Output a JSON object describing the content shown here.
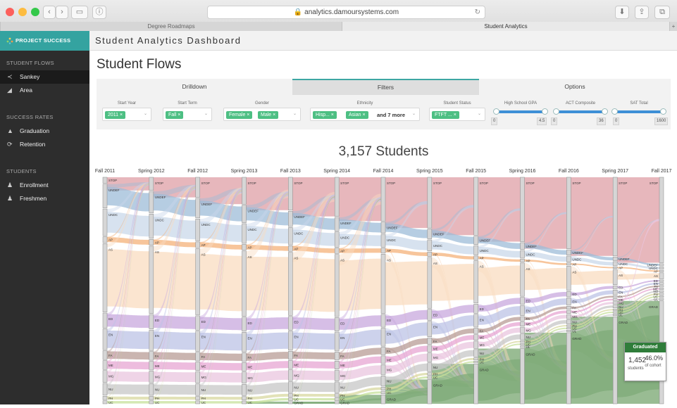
{
  "browser": {
    "url": "analytics.damoursystems.com",
    "tabs": [
      "Degree Roadmaps",
      "Student Analytics"
    ],
    "new_tab": "+"
  },
  "sidebar": {
    "brand": "PROJECT SUCCESS",
    "sections": [
      {
        "title": "STUDENT FLOWS",
        "items": [
          {
            "label": "Sankey",
            "icon": "share-icon",
            "active": true
          },
          {
            "label": "Area",
            "icon": "area-chart-icon"
          }
        ]
      },
      {
        "title": "SUCCESS RATES",
        "items": [
          {
            "label": "Graduation",
            "icon": "graduation-cap-icon"
          },
          {
            "label": "Retention",
            "icon": "refresh-icon"
          }
        ]
      },
      {
        "title": "STUDENTS",
        "items": [
          {
            "label": "Enrollment",
            "icon": "users-icon"
          },
          {
            "label": "Freshmen",
            "icon": "users-icon"
          }
        ]
      }
    ]
  },
  "header": {
    "title": "Student Analytics Dashboard"
  },
  "page": {
    "title": "Student Flows"
  },
  "panel": {
    "tabs": [
      "Drilldown",
      "Filters",
      "Options"
    ],
    "active_tab": "Filters",
    "filters": {
      "start_year": {
        "label": "Start Year",
        "chips": [
          "2011"
        ]
      },
      "start_term": {
        "label": "Start Term",
        "chips": [
          "Fall"
        ]
      },
      "gender": {
        "label": "Gender",
        "chips": [
          "Female",
          "Male"
        ]
      },
      "ethnicity": {
        "label": "Ethnicity",
        "chips": [
          "Hisp...",
          "Asian"
        ],
        "more": "and 7 more"
      },
      "student_status": {
        "label": "Student Status",
        "chips": [
          "FTFT ..."
        ]
      },
      "hs_gpa": {
        "label": "High School GPA",
        "min": "0",
        "max": "4.5"
      },
      "act": {
        "label": "ACT Composite",
        "min": "0",
        "max": "36"
      },
      "sat": {
        "label": "SAT Total",
        "min": "0",
        "max": "1600"
      }
    },
    "remove_glyph": "×",
    "chevron_glyph": "⌄"
  },
  "chart_data": {
    "type": "sankey",
    "title": "3,157 Students",
    "columns": [
      "Fall 2011",
      "Spring 2012",
      "Fall 2012",
      "Spring 2013",
      "Fall 2013",
      "Spring 2014",
      "Fall 2014",
      "Spring 2015",
      "Fall 2015",
      "Spring 2016",
      "Fall 2016",
      "Spring 2017",
      "Fall 2017"
    ],
    "node_labels": {
      "Fall 2011": [
        "STOP",
        "UNDEF",
        "UNDC",
        "AP",
        "AS",
        "ED",
        "EN",
        "FA",
        "ME",
        "MG",
        "NU",
        "PH",
        "UC"
      ],
      "Spring 2012": [
        "STOP",
        "UNDEF",
        "UNDC",
        "AP",
        "AS",
        "ED",
        "EN",
        "FA",
        "ME",
        "MG",
        "NU",
        "PH",
        "UC"
      ],
      "Fall 2012": [
        "STOP",
        "UNDEF",
        "UNDC",
        "AP",
        "AS",
        "ED",
        "EN",
        "FA",
        "ME",
        "MG",
        "NU",
        "PH",
        "UC"
      ],
      "Spring 2013": [
        "STOP",
        "UNDEF",
        "UNDC",
        "AP",
        "AS",
        "ED",
        "EN",
        "FA",
        "ME",
        "MG",
        "NU",
        "PH",
        "UC"
      ],
      "Fall 2013": [
        "STOP",
        "UNDEF",
        "UNDC",
        "AP",
        "AS",
        "ED",
        "EN",
        "FA",
        "ME",
        "MG",
        "NU",
        "PH",
        "UC",
        "GRAD"
      ],
      "Spring 2014": [
        "STOP",
        "UNDEF",
        "UNDC",
        "AP",
        "AS",
        "ED",
        "EN",
        "FA",
        "ME",
        "MG",
        "NU",
        "PH",
        "UC",
        "GRAD"
      ],
      "Fall 2014": [
        "STOP",
        "UNDEF",
        "UNDC",
        "AP",
        "AS",
        "ED",
        "EN",
        "FA",
        "ME",
        "MG",
        "NU",
        "PH",
        "UC",
        "GRAD"
      ],
      "Spring 2015": [
        "STOP",
        "UNDEF",
        "UNDC",
        "AP",
        "AS",
        "ED",
        "EN",
        "FA",
        "ME",
        "MG",
        "NU",
        "PH",
        "UC",
        "GRAD"
      ],
      "Fall 2015": [
        "STOP",
        "UNDEF",
        "UNDC",
        "AP",
        "AS",
        "ED",
        "EN",
        "FA",
        "ME",
        "MG",
        "NU",
        "PH",
        "UC",
        "GRAD"
      ],
      "Spring 2016": [
        "STOP",
        "UNDEF",
        "UNDC",
        "AP",
        "AS",
        "ED",
        "EN",
        "FA",
        "ME",
        "MG",
        "NU",
        "PH",
        "UC",
        "UL",
        "GRAD"
      ],
      "Fall 2016": [
        "STOP",
        "UNDEF",
        "UNDC",
        "AP",
        "AS",
        "ED",
        "EN",
        "FA",
        "ME",
        "MG",
        "NU",
        "PH",
        "UC",
        "UL",
        "GRAD"
      ],
      "Spring 2017": [
        "STOP",
        "UNDEF",
        "UNDC",
        "AP",
        "AS",
        "ED",
        "EN",
        "FA",
        "ME",
        "MG",
        "NU",
        "PH",
        "UC",
        "UL",
        "GRAD"
      ],
      "Fall 2017": [
        "STOP",
        "UNDEF",
        "UNDC",
        "AP",
        "AS",
        "ED",
        "EN",
        "FA",
        "ME",
        "NU",
        "PH",
        "UC",
        "UL",
        "GRAD"
      ]
    },
    "flow_colors": {
      "STOP": "#e3aab0",
      "UNDEF": "#9dbcd8",
      "UNDC": "#c9d8ea",
      "AP": "#f4b27a",
      "AS": "#f9dcc0",
      "ED": "#c8a8dd",
      "EN": "#bcc3e6",
      "FA": "#b89c96",
      "ME": "#e7a5d3",
      "MG": "#eac6df",
      "NU": "#c7c7c7",
      "PH": "#d8d8a0",
      "UC": "#c6e09a",
      "GRAD": "#7fab78"
    },
    "tooltip": {
      "title": "Graduated",
      "count": "1,452",
      "count_label": "students",
      "percent": "46.0%",
      "percent_label": "of cohort"
    }
  }
}
